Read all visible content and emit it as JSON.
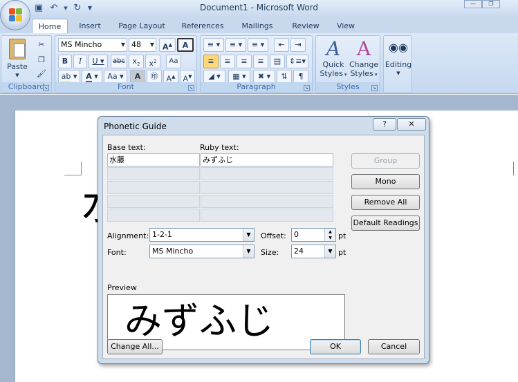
{
  "window": {
    "title": "Document1 - Microsoft Word"
  },
  "qat": {
    "save_icon": "save-icon",
    "undo_icon": "undo-icon",
    "redo_icon": "redo-icon"
  },
  "tabs": [
    "Home",
    "Insert",
    "Page Layout",
    "References",
    "Mailings",
    "Review",
    "View"
  ],
  "ribbon": {
    "clipboard": {
      "label": "Clipboard",
      "paste": "Paste"
    },
    "font": {
      "label": "Font",
      "font_name": "MS Mincho",
      "font_size": "48"
    },
    "paragraph": {
      "label": "Paragraph"
    },
    "styles": {
      "label": "Styles",
      "quick_styles": "Quick",
      "quick_styles2": "Styles",
      "change_styles": "Change",
      "change_styles2": "Styles"
    },
    "editing": {
      "label": "Editing"
    }
  },
  "document": {
    "visible_char": "水"
  },
  "dialog": {
    "title": "Phonetic Guide",
    "help": "?",
    "base_text_label": "Base text:",
    "ruby_text_label": "Ruby text:",
    "rows": [
      {
        "base": "水藤",
        "ruby": "みずふじ"
      },
      {
        "base": "",
        "ruby": ""
      },
      {
        "base": "",
        "ruby": ""
      },
      {
        "base": "",
        "ruby": ""
      },
      {
        "base": "",
        "ruby": ""
      }
    ],
    "buttons": {
      "group": "Group",
      "mono": "Mono",
      "remove_all": "Remove All",
      "default_readings": "Default Readings",
      "change_all": "Change All...",
      "ok": "OK",
      "cancel": "Cancel"
    },
    "alignment_label": "Alignment:",
    "alignment_value": "1-2-1",
    "offset_label": "Offset:",
    "offset_value": "0",
    "offset_unit": "pt",
    "font_label": "Font:",
    "font_value": "MS Mincho",
    "size_label": "Size:",
    "size_value": "24",
    "size_unit": "pt",
    "preview_label": "Preview",
    "preview_text": "みずふじ"
  }
}
